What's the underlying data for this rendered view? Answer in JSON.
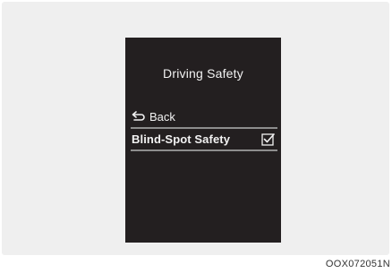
{
  "screen": {
    "title": "Driving Safety",
    "menu": {
      "back_label": "Back",
      "back_icon": "return-arrow-icon",
      "items": [
        {
          "label": "Blind-Spot Safety",
          "checked": true,
          "icon": "checkbox-checked-icon"
        }
      ]
    }
  },
  "caption": "OOX072051N",
  "colors": {
    "screen_bg": "#231f20",
    "frame_bg": "#efefef",
    "text": "#f2f2f2",
    "divider": "#8d8d8d"
  }
}
